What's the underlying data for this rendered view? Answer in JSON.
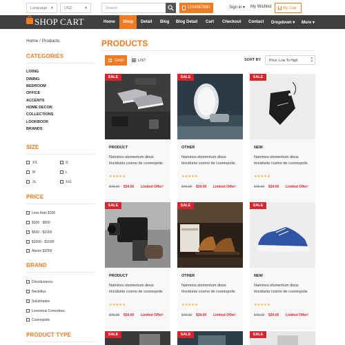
{
  "topbar": {
    "language": "Language",
    "currency": "USD",
    "search_placeholder": "Search",
    "phone": "1234567890",
    "signin": "Sign in ▾",
    "wishlist": "My Wishlist",
    "cart": "My Cart"
  },
  "nav": {
    "logo": "SHOP CART",
    "items": [
      "Home",
      "Shop",
      "Detail",
      "Blog",
      "Blog Detail",
      "Cart",
      "Checkout",
      "Contact",
      "Dropdown ▾",
      "More ▾"
    ]
  },
  "sidebar": {
    "breadcrumb": "Home / Products",
    "categories_title": "CATEGORIES",
    "categories": [
      "LIVING",
      "DINING",
      "BEDROOM",
      "OFFICE",
      "ACCENTS",
      "HOME DECOR",
      "COLLECTIONS",
      "LOOKBOOK",
      "BRANDS"
    ],
    "size_title": "SIZE",
    "sizes": [
      "XS",
      "S",
      "M",
      "L",
      "XL",
      "XXL"
    ],
    "price_title": "PRICE",
    "prices": [
      "Less than $100",
      "$100 - $500",
      "$500 - $1000",
      "$1000 - $1500",
      "Above $2000"
    ],
    "brand_title": "BRAND",
    "brands": [
      "Dincidunteros",
      "Nectellus",
      "Solutmades",
      "Loremous Comodous",
      "Cosmopolis"
    ],
    "product_type_title": "PRODUCT TYPE"
  },
  "main": {
    "title": "PRODUCTS",
    "grid_label": "GRID",
    "list_label": "LIST",
    "sort_label": "SORT BY",
    "sort_value": "Price, Low To High",
    "products": [
      {
        "sale": "SALE",
        "category": "PRODUCT",
        "desc": "Naminos elementum disus tincidunts cosmo de cosmopolis",
        "stars": "★★★★★",
        "old_price": "$45.00",
        "new_price": "$34.00",
        "offer": "Limited Offer!"
      },
      {
        "sale": "SALE",
        "category": "OTHER",
        "desc": "Naminos elementum disus tincidunts cosmo de cosmopolis",
        "stars": "★★★★★",
        "old_price": "$45.00",
        "new_price": "$34.00",
        "offer": "Limited Offer!"
      },
      {
        "sale": "SALE",
        "category": "NEW",
        "desc": "Naminos elementum disus tincidunts cosmo de cosmopolis",
        "stars": "★★★★★",
        "old_price": "$45.00",
        "new_price": "$34.00",
        "offer": "Limited Offer!"
      },
      {
        "sale": "SALE",
        "category": "PRODUCT",
        "desc": "Naminos elementum disus tincidunts cosmo de cosmopolis",
        "stars": "★★★★★",
        "old_price": "$45.00",
        "new_price": "$34.00",
        "offer": "Limited Offer!"
      },
      {
        "sale": "SALE",
        "category": "OTHER",
        "desc": "Naminos elementum disus tincidunts cosmo de cosmopolis",
        "stars": "★★★★★",
        "old_price": "$45.00",
        "new_price": "$34.00",
        "offer": "Limited Offer!"
      },
      {
        "sale": "SALE",
        "category": "NEW",
        "desc": "Naminos elementum disus tincidunts cosmo de cosmopolis",
        "stars": "★★★★★",
        "old_price": "$45.00",
        "new_price": "$34.00",
        "offer": "Limited Offer!"
      },
      {
        "sale": "SALE"
      },
      {
        "sale": "SALE"
      },
      {
        "sale": "SALE"
      }
    ]
  },
  "colors": {
    "accent": "#f07b22",
    "nav_bg": "#404040",
    "sale": "#d9232d",
    "stars": "#f0a522"
  }
}
